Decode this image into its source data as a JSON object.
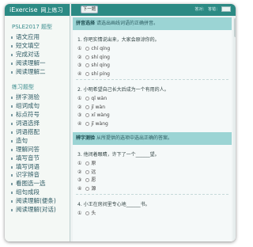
{
  "app": {
    "title_en": "iExercise",
    "title_cn": "网上练习"
  },
  "sidebar": {
    "sections": [
      {
        "title": "PSLE2017 题型",
        "items": [
          "语文应用",
          "短文填空",
          "完成对话",
          "阅读理解一",
          "阅读理解二"
        ]
      },
      {
        "title": "练习题型",
        "items": [
          "拼字测验",
          "组词成句",
          "标点符号",
          "词语选择",
          "词语搭配",
          "造句",
          "理解问答",
          "填写音节",
          "填写词语",
          "识字辨音",
          "看图选一选",
          "组句成段",
          "阅读理解(便条)",
          "阅读理解(对话)"
        ]
      }
    ]
  },
  "toolbar": {
    "next_label": "下一题",
    "stats": "答对：  答错："
  },
  "content": {
    "band1": {
      "tag": "拼音选择",
      "text": "请选出画线词语的正确拼音。"
    },
    "q1": {
      "text": "1. 你吧实情说出来，大家会原谅你的。",
      "options": [
        {
          "label": "①",
          "text": "chí   qíng"
        },
        {
          "label": "②",
          "text": "shí   qìng"
        },
        {
          "label": "③",
          "text": "shí   qíng"
        },
        {
          "label": "④",
          "text": "shí   píng"
        }
      ]
    },
    "q2": {
      "text": "2. 小明希望自己长大后成为一个有用的人。",
      "options": [
        {
          "label": "①",
          "text": "qī   wàn"
        },
        {
          "label": "②",
          "text": "jī   wàn"
        },
        {
          "label": "③",
          "text": "xī   wàng"
        },
        {
          "label": "④",
          "text": "jī   wàng"
        }
      ]
    },
    "band2": {
      "tag": "辨字测验",
      "text": "从所提供的选项中选出正确的答案。"
    },
    "q3": {
      "text": "3. 他闭着眼睛，许下了一个______望。",
      "options": [
        {
          "label": "①",
          "text": "原"
        },
        {
          "label": "②",
          "text": "远"
        },
        {
          "label": "③",
          "text": "愿"
        },
        {
          "label": "④",
          "text": "源"
        }
      ]
    },
    "q4": {
      "text": "4. 小王在房间里专心地______书。",
      "options": [
        {
          "label": "①",
          "text": "头"
        }
      ]
    }
  }
}
